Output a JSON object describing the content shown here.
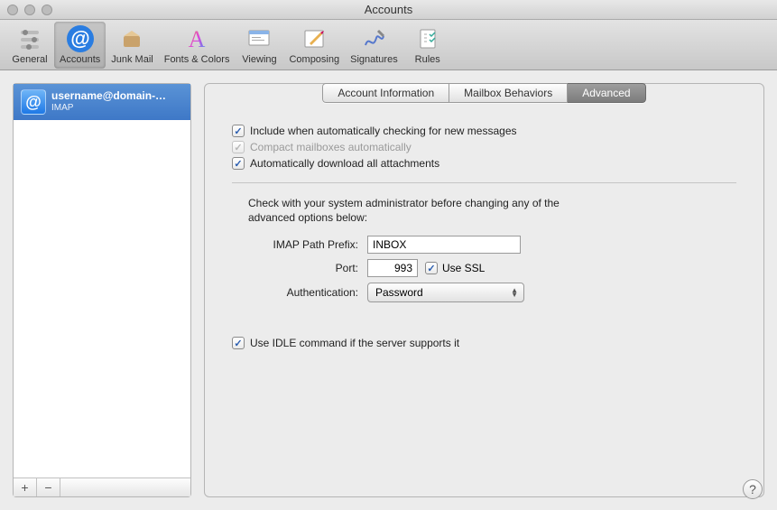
{
  "window": {
    "title": "Accounts"
  },
  "toolbar": {
    "items": [
      {
        "label": "General"
      },
      {
        "label": "Accounts"
      },
      {
        "label": "Junk Mail"
      },
      {
        "label": "Fonts & Colors"
      },
      {
        "label": "Viewing"
      },
      {
        "label": "Composing"
      },
      {
        "label": "Signatures"
      },
      {
        "label": "Rules"
      }
    ]
  },
  "sidebar": {
    "account": {
      "name": "username@domain-…",
      "type": "IMAP"
    },
    "add": "+",
    "remove": "−"
  },
  "tabs": {
    "info": "Account Information",
    "mailbox": "Mailbox Behaviors",
    "advanced": "Advanced"
  },
  "checks": {
    "include": "Include when automatically checking for new messages",
    "compact": "Compact mailboxes automatically",
    "download": "Automatically download all attachments",
    "idle": "Use IDLE command if the server supports it"
  },
  "note": "Check with your system administrator before changing any of the advanced options below:",
  "form": {
    "prefix_label": "IMAP Path Prefix:",
    "prefix_value": "INBOX",
    "port_label": "Port:",
    "port_value": "993",
    "ssl_label": "Use SSL",
    "auth_label": "Authentication:",
    "auth_value": "Password"
  },
  "help": "?"
}
